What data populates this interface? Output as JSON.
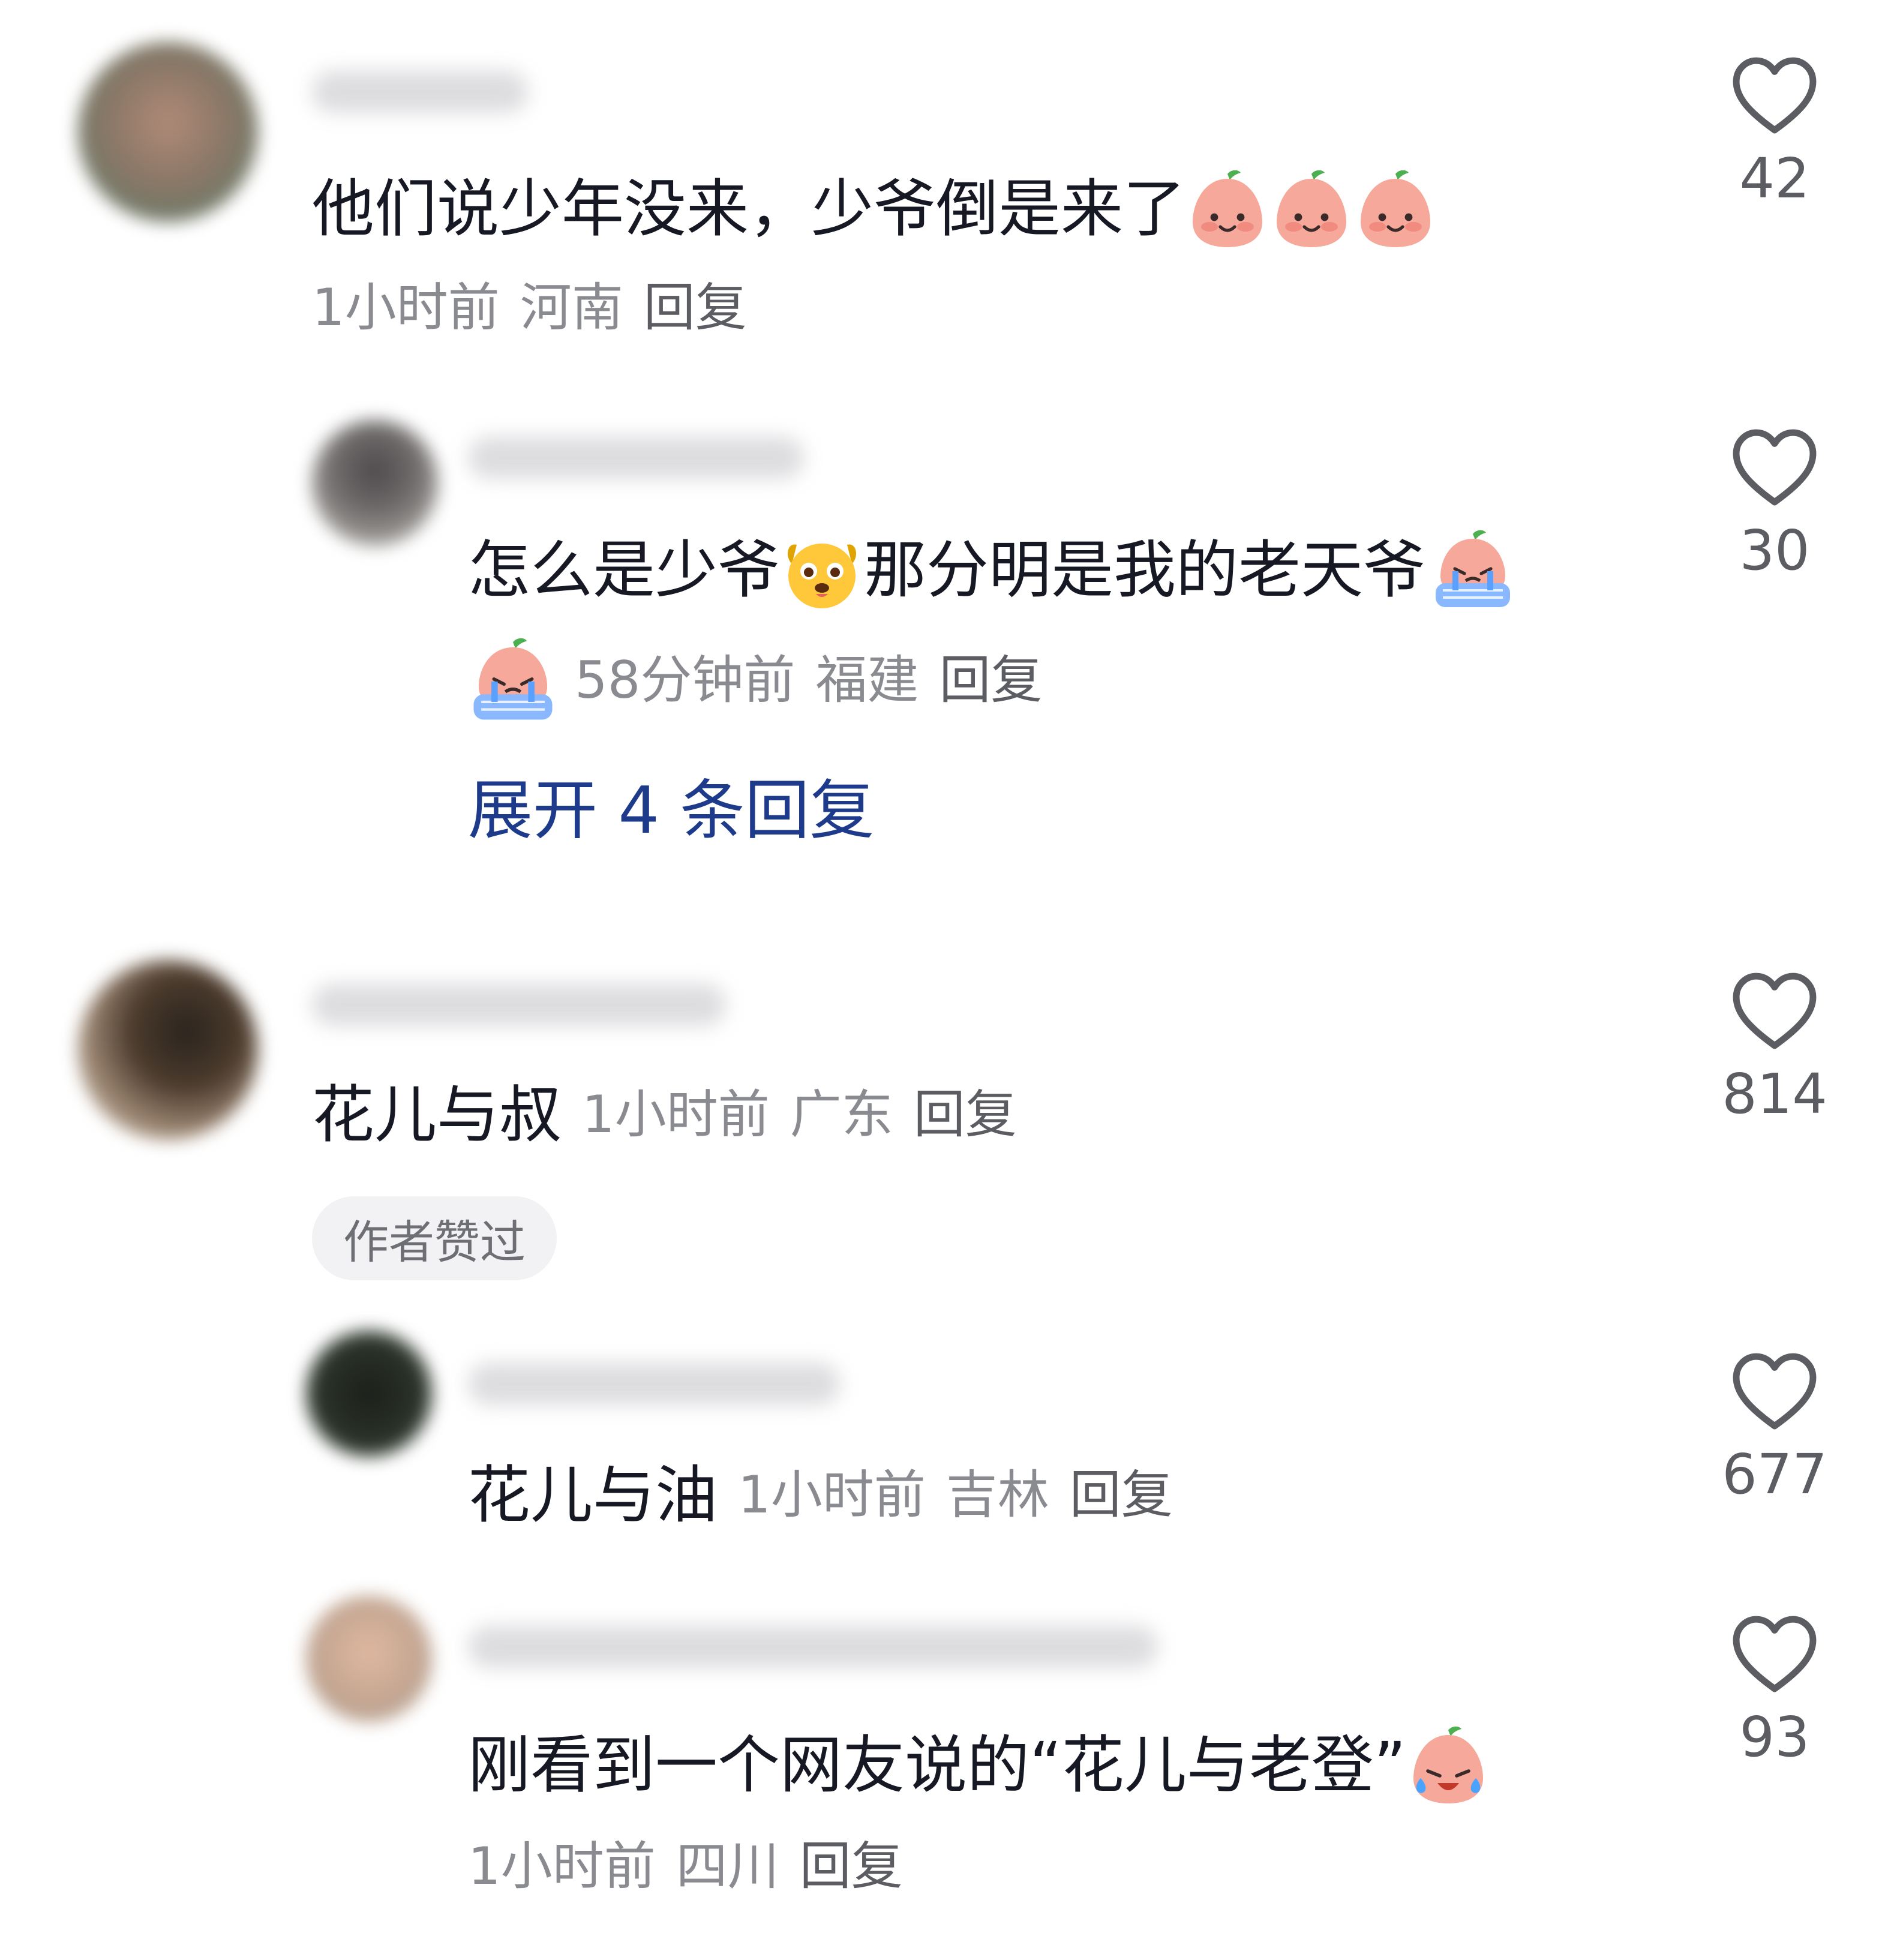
{
  "comments": [
    {
      "text": "他们说少年没来，少爷倒是来了",
      "emojis": [
        "peach-smile-emoji",
        "peach-smile-emoji",
        "peach-smile-emoji"
      ],
      "time": "1小时前",
      "region": "河南",
      "reply_label": "回复",
      "likes": "42",
      "replies": [
        {
          "text_part1": "怎么是少爷",
          "text_part2": "那分明是我的老天爷",
          "emojis": [
            "dog-face-emoji",
            "peach-crying-bath-emoji",
            "peach-crying-bath-emoji"
          ],
          "time": "58分钟前",
          "region": "福建",
          "reply_label": "回复",
          "likes": "30"
        }
      ],
      "expand_label": "展开 4 条回复"
    },
    {
      "text": "花儿与叔",
      "time": "1小时前",
      "region": "广东",
      "reply_label": "回复",
      "likes": "814",
      "badge": "作者赞过",
      "replies": [
        {
          "text": "花儿与油",
          "time": "1小时前",
          "region": "吉林",
          "reply_label": "回复",
          "likes": "677"
        },
        {
          "text": "刚看到一个网友说的“花儿与老登”",
          "emojis": [
            "peach-laugh-cry-emoji"
          ],
          "time": "1小时前",
          "region": "四川",
          "reply_label": "回复",
          "likes": "93"
        }
      ]
    }
  ],
  "colors": {
    "text": "#161823",
    "meta": "#8a8b91",
    "expand_link": "#1e3a8a",
    "heart_stroke": "#5c5d63",
    "peach": "#f6a89a"
  }
}
